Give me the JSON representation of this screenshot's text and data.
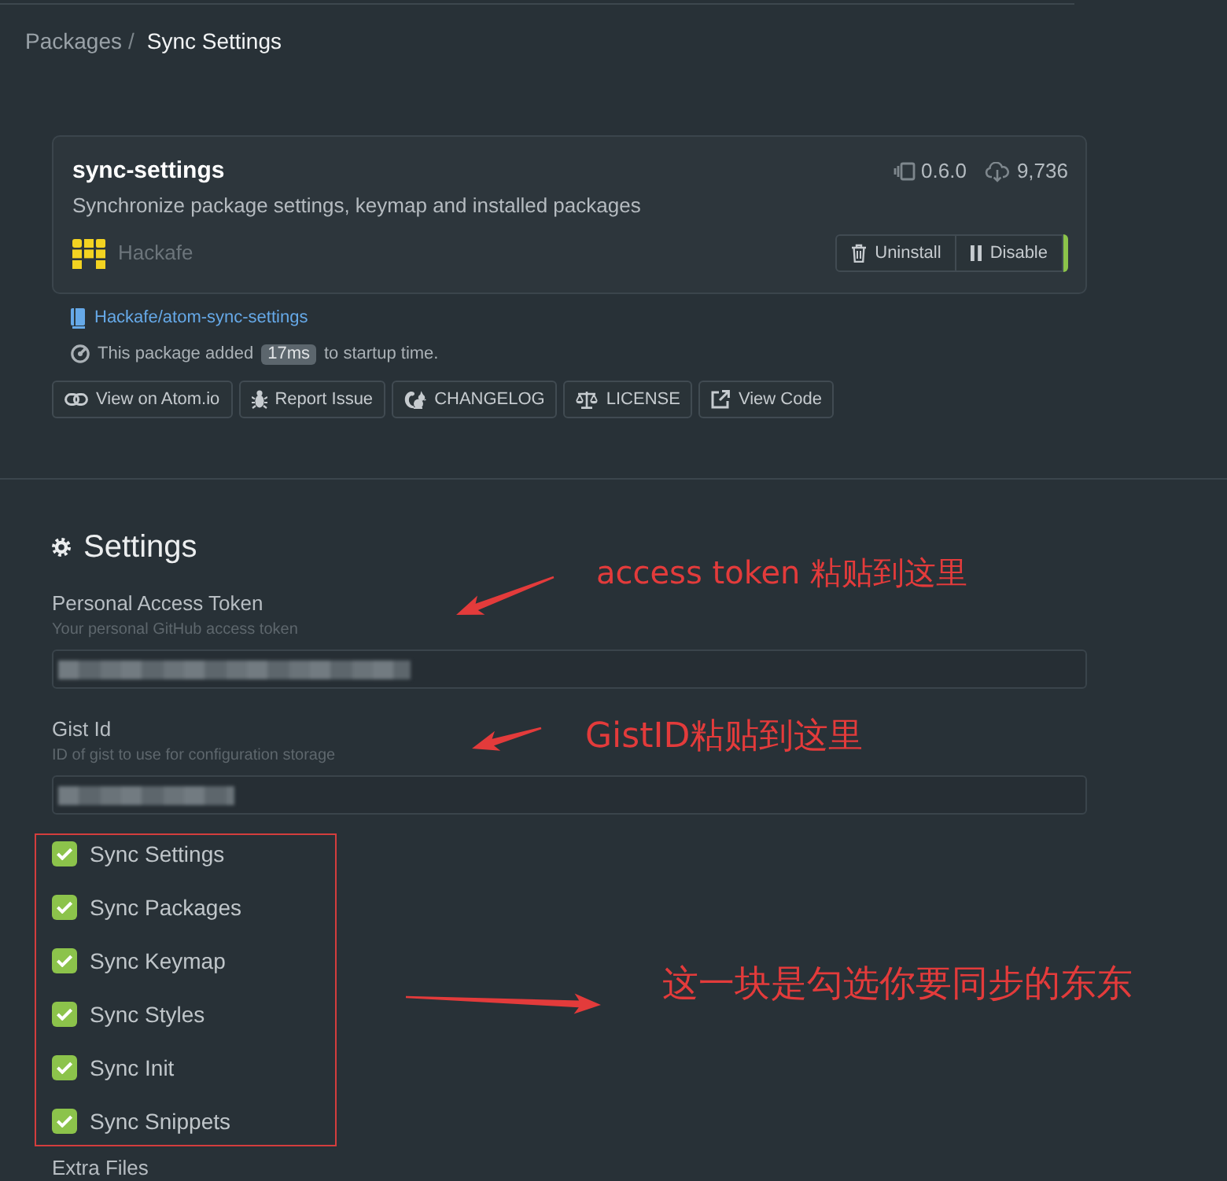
{
  "breadcrumb": {
    "items": [
      {
        "label": "Packages",
        "selected": false
      },
      {
        "label": "Sync Settings",
        "selected": true
      }
    ],
    "separator": "/"
  },
  "package": {
    "name": "sync-settings",
    "version": "0.6.0",
    "downloads": "9,736",
    "description": "Synchronize package settings, keymap and installed packages",
    "author": "Hackafe",
    "actions": [
      {
        "kind": "uninstall",
        "label": "Uninstall"
      },
      {
        "kind": "disable",
        "label": "Disable"
      }
    ],
    "enabled": true,
    "repository": "Hackafe/atom-sync-settings",
    "startup": {
      "before": "This package added",
      "time": "17ms",
      "after": "to startup time."
    },
    "links": [
      {
        "kind": "atom",
        "label": "View on Atom.io"
      },
      {
        "kind": "issue",
        "label": "Report Issue"
      },
      {
        "kind": "changelog",
        "label": "CHANGELOG"
      },
      {
        "kind": "license",
        "label": "LICENSE"
      },
      {
        "kind": "code",
        "label": "View Code"
      }
    ]
  },
  "settings": {
    "title": "Settings",
    "fields": [
      {
        "kind": "token",
        "label": "Personal Access Token",
        "description": "Your personal GitHub access token",
        "redacted": true
      },
      {
        "kind": "id",
        "label": "Gist Id",
        "description": "ID of gist to use for configuration storage",
        "redacted": true
      }
    ],
    "options": [
      {
        "label": "Sync Settings",
        "checked": true
      },
      {
        "label": "Sync Packages",
        "checked": true
      },
      {
        "label": "Sync Keymap",
        "checked": true
      },
      {
        "label": "Sync Styles",
        "checked": true
      },
      {
        "label": "Sync Init",
        "checked": true
      },
      {
        "label": "Sync Snippets",
        "checked": true
      }
    ],
    "next_label": "Extra Files"
  },
  "annotations": {
    "frame_around_options": true,
    "notes": [
      {
        "text": "access token 粘贴到这里",
        "arrow": true
      },
      {
        "text": "GistID粘贴到这里",
        "arrow": true
      },
      {
        "text": "这一块是勾选你要同步的东东",
        "arrow": true
      }
    ]
  }
}
